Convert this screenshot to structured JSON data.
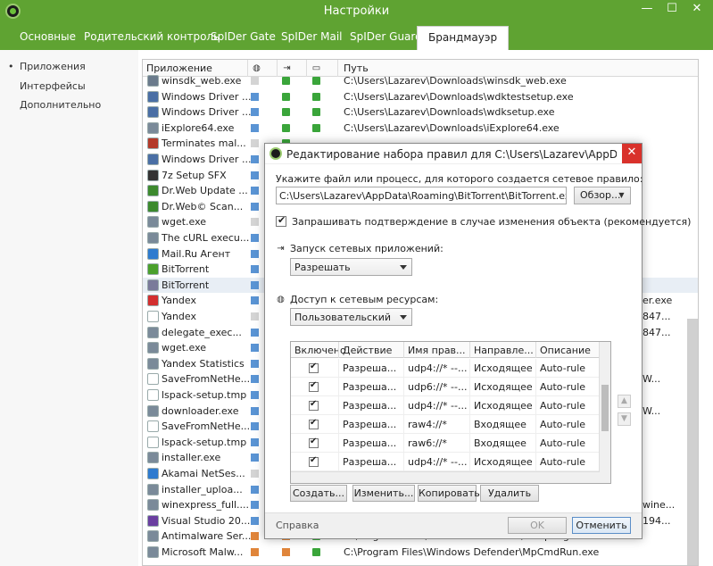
{
  "window": {
    "title": "Настройки",
    "minimize": "—",
    "maximize": "☐",
    "close": "✕"
  },
  "tabs": [
    {
      "label": "Основные"
    },
    {
      "label": "Родительский контроль"
    },
    {
      "label": "SpIDer Gate"
    },
    {
      "label": "SpIDer Mail"
    },
    {
      "label": "SpIDer Guard"
    },
    {
      "label": "Брандмауэр"
    }
  ],
  "sidebar": {
    "items": [
      {
        "label": "Приложения"
      },
      {
        "label": "Интерфейсы"
      },
      {
        "label": "Дополнительно"
      }
    ]
  },
  "table": {
    "headers": {
      "app": "Приложение",
      "path": "Путь"
    },
    "rows": [
      {
        "name": "winsdk_web.exe",
        "icon": "#6b7b8c",
        "c1": "none",
        "c2": "allow",
        "c3": "allow",
        "path": "C:\\Users\\Lazarev\\Downloads\\winsdk_web.exe",
        "tail": ""
      },
      {
        "name": "Windows Driver ...",
        "icon": "#4a6fa5",
        "c1": "custom",
        "c2": "allow",
        "c3": "allow",
        "path": "C:\\Users\\Lazarev\\Downloads\\wdktestsetup.exe",
        "tail": ""
      },
      {
        "name": "Windows Driver ...",
        "icon": "#4a6fa5",
        "c1": "custom",
        "c2": "allow",
        "c3": "allow",
        "path": "C:\\Users\\Lazarev\\Downloads\\wdksetup.exe",
        "tail": ""
      },
      {
        "name": "iExplore64.exe",
        "icon": "#7a8a99",
        "c1": "custom",
        "c2": "allow",
        "c3": "allow",
        "path": "C:\\Users\\Lazarev\\Downloads\\iExplore64.exe",
        "tail": ""
      },
      {
        "name": "Terminates mal...",
        "icon": "#b43a2a",
        "c1": "none",
        "c2": "allow",
        "c3": "",
        "path": "",
        "tail": ""
      },
      {
        "name": "Windows Driver ...",
        "icon": "#4a6fa5",
        "c1": "custom",
        "c2": "",
        "c3": "",
        "path": "",
        "tail": ""
      },
      {
        "name": "7z Setup SFX",
        "icon": "#333333",
        "c1": "custom",
        "c2": "",
        "c3": "",
        "path": "",
        "tail": ""
      },
      {
        "name": "Dr.Web Update ...",
        "icon": "#3c8a2e",
        "c1": "custom",
        "c2": "",
        "c3": "",
        "path": "",
        "tail": ""
      },
      {
        "name": "Dr.Web© Scan...",
        "icon": "#3c8a2e",
        "c1": "custom",
        "c2": "",
        "c3": "",
        "path": "",
        "tail": ""
      },
      {
        "name": "wget.exe",
        "icon": "#7a8a99",
        "c1": "none",
        "c2": "",
        "c3": "",
        "path": "",
        "tail": ""
      },
      {
        "name": "The cURL execu...",
        "icon": "#7a8a99",
        "c1": "custom",
        "c2": "",
        "c3": "",
        "path": "",
        "tail": ""
      },
      {
        "name": "Mail.Ru Агент",
        "icon": "#2e7bcf",
        "c1": "custom",
        "c2": "",
        "c3": "",
        "path": "",
        "tail": ""
      },
      {
        "name": "BitTorrent",
        "icon": "#4aa02c",
        "c1": "custom",
        "c2": "",
        "c3": "",
        "path": "",
        "tail": ""
      },
      {
        "name": "BitTorrent",
        "icon": "#7a7a9a",
        "c1": "custom",
        "c2": "",
        "c3": "",
        "path": "",
        "tail": "",
        "selected": true
      },
      {
        "name": "Yandex",
        "icon": "#d32f2f",
        "c1": "custom",
        "c2": "",
        "c3": "",
        "path": "",
        "tail": "er.exe"
      },
      {
        "name": "Yandex",
        "icon": "#ffffff",
        "c1": "none",
        "c2": "",
        "c3": "",
        "path": "",
        "tail": "847..."
      },
      {
        "name": "delegate_exec...",
        "icon": "#7a8a99",
        "c1": "custom",
        "c2": "",
        "c3": "",
        "path": "",
        "tail": "847..."
      },
      {
        "name": "wget.exe",
        "icon": "#7a8a99",
        "c1": "custom",
        "c2": "",
        "c3": "",
        "path": "",
        "tail": ""
      },
      {
        "name": "Yandex Statistics",
        "icon": "#7a8a99",
        "c1": "custom",
        "c2": "",
        "c3": "",
        "path": "",
        "tail": ""
      },
      {
        "name": "SaveFromNetHe...",
        "icon": "#ffffff",
        "c1": "custom",
        "c2": "",
        "c3": "",
        "path": "",
        "tail": "W..."
      },
      {
        "name": "lspack-setup.tmp",
        "icon": "#ffffff",
        "c1": "custom",
        "c2": "",
        "c3": "",
        "path": "",
        "tail": ""
      },
      {
        "name": "downloader.exe",
        "icon": "#7a8a99",
        "c1": "custom",
        "c2": "",
        "c3": "",
        "path": "",
        "tail": "W..."
      },
      {
        "name": "SaveFromNetHe...",
        "icon": "#ffffff",
        "c1": "custom",
        "c2": "",
        "c3": "",
        "path": "",
        "tail": ""
      },
      {
        "name": "lspack-setup.tmp",
        "icon": "#ffffff",
        "c1": "custom",
        "c2": "",
        "c3": "",
        "path": "",
        "tail": ""
      },
      {
        "name": "installer.exe",
        "icon": "#7a8a99",
        "c1": "custom",
        "c2": "",
        "c3": "",
        "path": "",
        "tail": ""
      },
      {
        "name": "Akamai NetSes...",
        "icon": "#2e7bcf",
        "c1": "none",
        "c2": "",
        "c3": "",
        "path": "",
        "tail": ""
      },
      {
        "name": "installer_uploa...",
        "icon": "#7a8a99",
        "c1": "custom",
        "c2": "",
        "c3": "",
        "path": "",
        "tail": ""
      },
      {
        "name": "winexpress_full....",
        "icon": "#7a8a99",
        "c1": "custom",
        "c2": "",
        "c3": "",
        "path": "",
        "tail": "wine..."
      },
      {
        "name": "Visual Studio 20...",
        "icon": "#6a3fa0",
        "c1": "custom",
        "c2": "",
        "c3": "",
        "path": "",
        "tail": "194..."
      },
      {
        "name": "Antimalware Ser...",
        "icon": "#7a8a99",
        "c1": "block",
        "c2": "block",
        "c3": "allow",
        "path": "C:\\Program Files\\Windows Defender\\MsMpEng.exe",
        "tail": ""
      },
      {
        "name": "Microsoft Malw...",
        "icon": "#7a8a99",
        "c1": "block",
        "c2": "block",
        "c3": "allow",
        "path": "C:\\Program Files\\Windows Defender\\MpCmdRun.exe",
        "tail": ""
      }
    ]
  },
  "dialog": {
    "title": "Редактирование набора правил для C:\\Users\\Lazarev\\AppData\\Roa...",
    "close": "✕",
    "file_label": "Укажите файл или процесс, для которого создается сетевое правило:",
    "file_value": "C:\\Users\\Lazarev\\AppData\\Roaming\\BitTorrent\\BitTorrent.exe",
    "browse_label": "Обзор...",
    "confirm_label": "Запрашивать подтверждение в случае изменения объекта (рекомендуется)",
    "launch_label": "Запуск сетевых приложений:",
    "launch_value": "Разрешать",
    "access_label": "Доступ к сетевым ресурсам:",
    "access_value": "Пользовательский",
    "rules": {
      "headers": {
        "enabled": "Включено",
        "action": "Действие",
        "rule": "Имя прав...",
        "direction": "Направле...",
        "desc": "Описание"
      },
      "rows": [
        {
          "action": "Разреша...",
          "rule": "udp4://* --...",
          "direction": "Исходящее",
          "desc": "Auto-rule"
        },
        {
          "action": "Разреша...",
          "rule": "udp6://* --...",
          "direction": "Исходящее",
          "desc": "Auto-rule"
        },
        {
          "action": "Разреша...",
          "rule": "udp4://* --...",
          "direction": "Исходящее",
          "desc": "Auto-rule"
        },
        {
          "action": "Разреша...",
          "rule": "raw4://*",
          "direction": "Входящее",
          "desc": "Auto-rule"
        },
        {
          "action": "Разреша...",
          "rule": "raw6://*",
          "direction": "Входящее",
          "desc": "Auto-rule"
        },
        {
          "action": "Разреша...",
          "rule": "udp4://* --...",
          "direction": "Исходящее",
          "desc": "Auto-rule"
        }
      ]
    },
    "buttons": {
      "create": "Создать...",
      "edit": "Изменить...",
      "copy": "Копировать",
      "delete": "Удалить"
    },
    "footer": {
      "help": "Справка",
      "ok": "OK",
      "cancel": "Отменить"
    }
  }
}
